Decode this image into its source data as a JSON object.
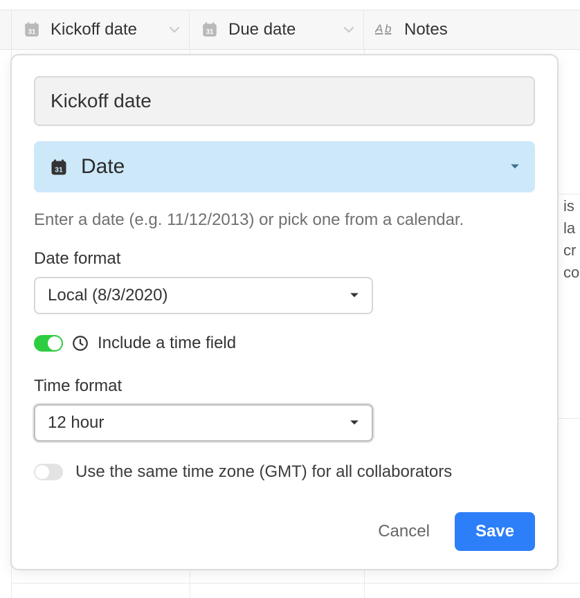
{
  "columns": {
    "kickoff": {
      "label": "Kickoff date"
    },
    "due": {
      "label": "Due date"
    },
    "notes": {
      "label": "Notes"
    }
  },
  "peek_text": "is la cr co",
  "popover": {
    "field_name": "Kickoff date",
    "type": {
      "label": "Date"
    },
    "helper": "Enter a date (e.g. 11/12/2013) or pick one from a calendar.",
    "date_format": {
      "label": "Date format",
      "value": "Local (8/3/2020)"
    },
    "include_time": {
      "label": "Include a time field",
      "on": true
    },
    "time_format": {
      "label": "Time format",
      "value": "12 hour"
    },
    "gmt": {
      "label": "Use the same time zone (GMT) for all collaborators",
      "on": false
    },
    "actions": {
      "cancel": "Cancel",
      "save": "Save"
    }
  }
}
